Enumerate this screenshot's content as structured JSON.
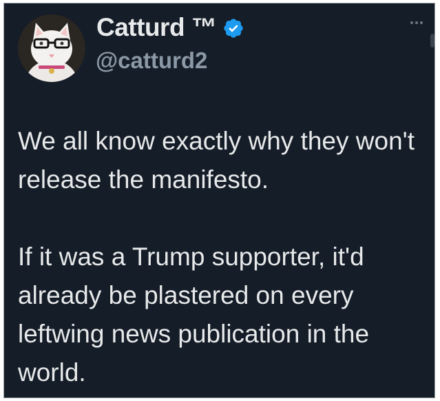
{
  "tweet": {
    "author": {
      "display_name": "Catturd ™",
      "handle": "@catturd2",
      "avatar_icon": "cat-with-glasses-avatar",
      "verified_icon": "verified-badge-icon",
      "verified_color": "#1d9bf0"
    },
    "more_icon": "ellipsis-icon",
    "paragraphs": [
      "We all know exactly why they won't release the manifesto.",
      "If it was a Trump supporter, it'd already be plastered on every leftwing news publication in the world."
    ]
  },
  "colors": {
    "background": "#151d28",
    "primary_text": "#e7e9ea",
    "secondary_text": "#8b98a5"
  }
}
